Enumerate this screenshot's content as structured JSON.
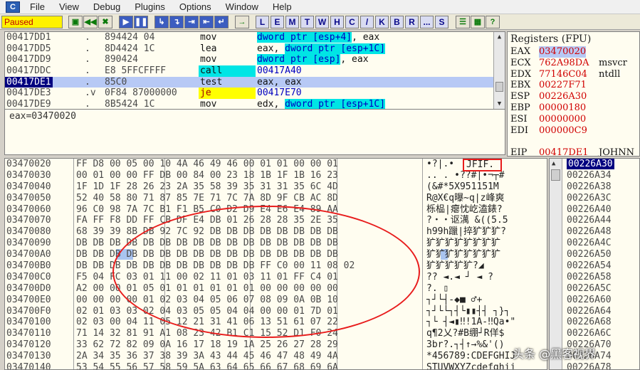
{
  "menu": {
    "app_icon": "C",
    "items": [
      "File",
      "View",
      "Debug",
      "Plugins",
      "Options",
      "Window",
      "Help"
    ]
  },
  "toolbar": {
    "status": "Paused",
    "buttons_a": [
      "open-icon",
      "rewind-icon",
      "close-icon"
    ],
    "buttons_a_glyphs": [
      "▣",
      "◀◀",
      "✖"
    ],
    "buttons_b_glyphs": [
      "▶",
      "❚❚"
    ],
    "buttons_c_glyphs": [
      "↳",
      "↴",
      "⇥",
      "⇤",
      "↵"
    ],
    "goto_glyph": "→",
    "letters": [
      "L",
      "E",
      "M",
      "T",
      "W",
      "H",
      "C",
      "/",
      "K",
      "B",
      "R",
      "...",
      "S"
    ],
    "right_glyphs": [
      "☰",
      "▦",
      "?"
    ]
  },
  "disasm": {
    "rows": [
      {
        "addr": "00417DD1",
        "mark": ".",
        "hex": "894424 04",
        "mnemonic": "mov",
        "ops": [
          {
            "t": "dword ptr [esp+4]",
            "s": "hl"
          },
          {
            "t": ", eax",
            "s": ""
          }
        ]
      },
      {
        "addr": "00417DD5",
        "mark": ".",
        "hex": "8D4424 1C",
        "mnemonic": "lea",
        "ops": [
          {
            "t": "eax, ",
            "s": ""
          },
          {
            "t": "dword ptr [esp+1C]",
            "s": "hl"
          }
        ]
      },
      {
        "addr": "00417DD9",
        "mark": ".",
        "hex": "890424",
        "mnemonic": "mov",
        "ops": [
          {
            "t": "dword ptr [esp]",
            "s": "hl"
          },
          {
            "t": ", eax",
            "s": ""
          }
        ]
      },
      {
        "addr": "00417DDC",
        "mark": ".",
        "hex": "E8 5FFCFFFF",
        "mnemonic": "call",
        "mn_style": "call",
        "ops": [
          {
            "t": "00417A40",
            "s": "blue"
          }
        ]
      },
      {
        "addr": "00417DE1",
        "mark": ".",
        "hex": "85C0",
        "mnemonic": "test",
        "ops": [
          {
            "t": "eax, eax",
            "s": ""
          }
        ],
        "selected": true
      },
      {
        "addr": "00417DE3",
        "mark": ".v",
        "hex": "0F84 87000000",
        "mnemonic": "je",
        "mn_style": "je",
        "ops": [
          {
            "t": "00417E70",
            "s": "blue"
          }
        ]
      },
      {
        "addr": "00417DE9",
        "mark": ".",
        "hex": "8B5424 1C",
        "mnemonic": "mov",
        "ops": [
          {
            "t": "edx, ",
            "s": ""
          },
          {
            "t": "dword ptr [esp+1C]",
            "s": "hl"
          }
        ]
      }
    ]
  },
  "info": {
    "text": "eax=03470020"
  },
  "registers": {
    "title": "Registers (FPU)",
    "rows": [
      {
        "name": "EAX",
        "value": "03470020",
        "comment": "",
        "selected": true
      },
      {
        "name": "ECX",
        "value": "762A98DA",
        "comment": "msvcr"
      },
      {
        "name": "EDX",
        "value": "77146C04",
        "comment": "ntdll"
      },
      {
        "name": "EBX",
        "value": "00227F71",
        "comment": ""
      },
      {
        "name": "ESP",
        "value": "00226A30",
        "comment": ""
      },
      {
        "name": "EBP",
        "value": "00000180",
        "comment": ""
      },
      {
        "name": "ESI",
        "value": "00000000",
        "comment": ""
      },
      {
        "name": "EDI",
        "value": "000000C9",
        "comment": ""
      },
      {
        "name": "",
        "value": "",
        "comment": ""
      },
      {
        "name": "EIP",
        "value": "00417DE1",
        "comment": "JOHNN"
      }
    ]
  },
  "dump": {
    "jfif_label": "JFIF.",
    "rows": [
      {
        "addr": "03470020",
        "bytes": "FF D8 00 05 00 10 4A 46 49 46 00 01 01 00 00 01",
        "ascii": "•?|.•"
      },
      {
        "addr": "03470030",
        "bytes": "00 01 00 00 FF DB 00 84 00 23 18 1B 1F 1B 16 23",
        "ascii": ".. . •??#|•¬┬#"
      },
      {
        "addr": "03470040",
        "bytes": "1F 1D 1F 28 26 23 2A 35 58 39 35 31 31 35 6C 4D",
        "ascii": "(&#*5X951151M"
      },
      {
        "addr": "03470050",
        "bytes": "52 40 58 80 71 87 85 7E 71 7C 7A 8D 9F CB AC 8D",
        "ascii": "R@X€q曝~q|z峰爽"
      },
      {
        "addr": "03470060",
        "bytes": "96 C0 98 7A 7C B1 F1 B5 C0 D2 D9 E4 E6 E4 89 AA",
        "ascii": "栎榀|瘪忱屹溘錶?"
      },
      {
        "addr": "03470070",
        "bytes": "FA FF F8 DD FF CB DF E4 DB 01 26 28 28 35 2E 35",
        "ascii": "?・・讴澫 &((5.5"
      },
      {
        "addr": "03470080",
        "bytes": "68 39 39 8B DB 92 7C 92 DB DB DB DB DB DB DB DB",
        "ascii": "h99h躐|捽犷犷犷?"
      },
      {
        "addr": "03470090",
        "bytes": "DB DB DB DB DB DB DB DB DB DB DB DB DB DB DB DB",
        "ascii": "犷犷犷犷犷犷犷犷"
      },
      {
        "addr": "034700A0",
        "bytes": "DB DB DB DB DB DB DB DB DB DB DB DB DB DB DB DB",
        "ascii": "犷犷犷犷犷犷犷犷"
      },
      {
        "addr": "034700B0",
        "bytes": "DB DB DB DB DB DB DB DB DB DB DB FF C0 00 11 08 02",
        "ascii": "犷犷犷犷犷?◢"
      },
      {
        "addr": "034700C0",
        "bytes": "F5 04 FC 03 01 11 00 02 11 01 03 11 01 FF C4 01",
        "ascii": "??  ◄.◄  ┘ ◄ ?"
      },
      {
        "addr": "034700D0",
        "bytes": "A2 00 00 01 05 01 01 01 01 01 01 00 00 00 00 00",
        "ascii": "?.  ▯"
      },
      {
        "addr": "034700E0",
        "bytes": "00 00 00 00 01 02 03 04 05 06 07 08 09 0A 0B 10",
        "ascii": "   ┐┘└┤-◆■ ♂+"
      },
      {
        "addr": "034700F0",
        "bytes": "02 01 03 03 02 04 03 05 05 04 04 00 00 01 7D 01",
        "ascii": "┐┘└└┐┤└▮▮┤┤  ┐}┐"
      },
      {
        "addr": "03470100",
        "bytes": "02 03 00 04 11 05 12 21 31 41 06 13 51 61 07 22",
        "ascii": "┐└ ┤◄▮‼!1A-‼Qa•\""
      },
      {
        "addr": "03470110",
        "bytes": "71 14 32 81 91 A1 08 23 42 B1 C1 15 52 D1 F0 24",
        "ascii": "q¶2乂?#B绷┘R佯$"
      },
      {
        "addr": "03470120",
        "bytes": "33 62 72 82 09 0A 16 17 18 19 1A 25 26 27 28 29",
        "ascii": "3br?.┐┤↑→%&'()"
      },
      {
        "addr": "03470130",
        "bytes": "2A 34 35 36 37 38 39 3A 43 44 45 46 47 48 49 4A",
        "ascii": "*456789:CDEFGHIJ"
      },
      {
        "addr": "03470140",
        "bytes": "53 54 55 56 57 58 59 5A 63 64 65 66 67 68 69 6A",
        "ascii": "STUVWXYZcdefghij"
      }
    ]
  },
  "stack": {
    "rows": [
      "00226A30",
      "00226A34",
      "00226A38",
      "00226A3C",
      "00226A40",
      "00226A44",
      "00226A48",
      "00226A4C",
      "00226A50",
      "00226A54",
      "00226A58",
      "00226A5C",
      "00226A60",
      "00226A64",
      "00226A68",
      "00226A6C",
      "00226A70",
      "00226A74",
      "00226A78"
    ]
  },
  "watermark": {
    "text": "头条 @黑客视界"
  }
}
